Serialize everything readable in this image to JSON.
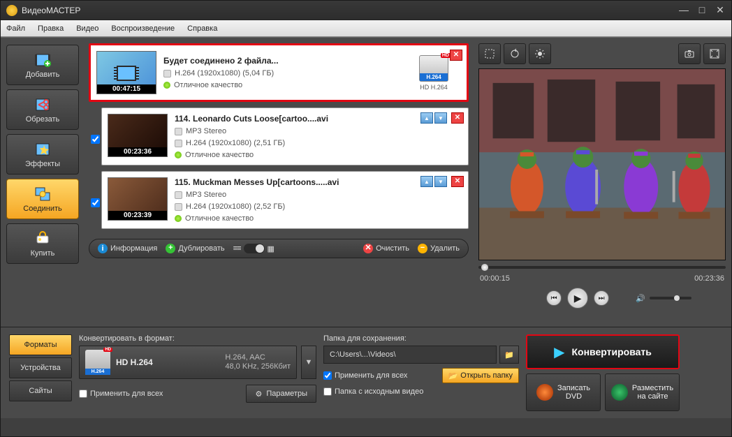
{
  "app": {
    "title": "ВидеоМАСТЕР"
  },
  "menu": [
    "Файл",
    "Правка",
    "Видео",
    "Воспроизведение",
    "Справка"
  ],
  "sidebar": [
    {
      "label": "Добавить"
    },
    {
      "label": "Обрезать"
    },
    {
      "label": "Эффекты"
    },
    {
      "label": "Соединить"
    },
    {
      "label": "Купить"
    }
  ],
  "items": [
    {
      "title": "Будет соединено 2 файла...",
      "line1": "H.264 (1920x1080) (5,04 ГБ)",
      "quality": "Отличное качество",
      "duration": "00:47:15",
      "fmt": "H.264",
      "fmttxt": "HD H.264",
      "hd": "HD"
    },
    {
      "title": "114. Leonardo Cuts Loose[cartoo....avi",
      "audio": "MP3 Stereo",
      "line1": "H.264 (1920x1080) (2,51 ГБ)",
      "quality": "Отличное качество",
      "duration": "00:23:36"
    },
    {
      "title": "115. Muckman Messes Up[cartoons.....avi",
      "audio": "MP3 Stereo",
      "line1": "H.264 (1920x1080) (2,52 ГБ)",
      "quality": "Отличное качество",
      "duration": "00:23:39"
    }
  ],
  "toolbar": {
    "info": "Информация",
    "dup": "Дублировать",
    "clear": "Очистить",
    "del": "Удалить"
  },
  "preview": {
    "cur": "00:00:15",
    "total": "00:23:36"
  },
  "tabs": {
    "formats": "Форматы",
    "devices": "Устройства",
    "sites": "Сайты"
  },
  "fmt": {
    "header": "Конвертировать в формат:",
    "name": "HD H.264",
    "spec1": "H.264, AAC",
    "spec2": "48,0 KHz, 256Кбит",
    "lbl": "H.264",
    "hd": "HD",
    "applyAll": "Применить для всех",
    "params": "Параметры"
  },
  "save": {
    "header": "Папка для сохранения:",
    "path": "C:\\Users\\...\\Videos\\",
    "applyAll": "Применить для всех",
    "srcFolder": "Папка с исходным видео",
    "open": "Открыть папку"
  },
  "actions": {
    "convert": "Конвертировать",
    "dvd": "Записать",
    "dvd2": "DVD",
    "site": "Разместить",
    "site2": "на сайте"
  }
}
